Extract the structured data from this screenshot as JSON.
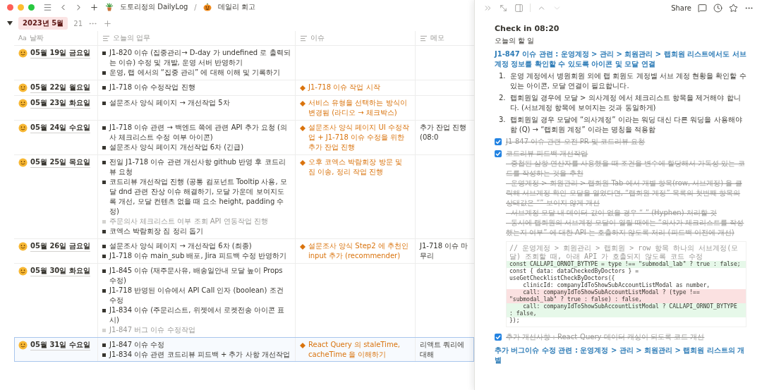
{
  "window": {
    "breadcrumbs": [
      {
        "label": "도토리정의 DailyLog"
      },
      {
        "label": "데일리 회고"
      }
    ],
    "separator": "/"
  },
  "group": {
    "label": "2023년 5월",
    "count": "21",
    "expanded": true
  },
  "table": {
    "columns": [
      {
        "kind": "title",
        "icon_text": "Aa",
        "label": "날짜"
      },
      {
        "kind": "text",
        "label": "오늘의 업무"
      },
      {
        "kind": "text",
        "label": "이슈"
      },
      {
        "kind": "text",
        "label": "메모"
      }
    ],
    "rows": [
      {
        "selected": false,
        "date": "05월 19일 금요일",
        "tasks": [
          {
            "text": "J1-820 이슈 (집중관리→ D-day 가 undefined 로 출력되는 이슈) 수정 및 개발, 운영 서버 반영하기",
            "muted": false
          },
          {
            "text": "운영, 랩 에서의 “집중 관리” 에 대해 이해 및 기록하기",
            "muted": false
          }
        ],
        "issues": []
      },
      {
        "selected": false,
        "date": "05월 22일 월요일",
        "tasks": [
          {
            "text": "J1-718 이슈 수정작업 진행",
            "muted": false
          }
        ],
        "issues": [
          "J1-718 이슈 작업 시작"
        ]
      },
      {
        "selected": false,
        "date": "05월 23일 화요일",
        "tasks": [
          {
            "text": "설문조사 양식 페이지 → 개선작업 5차",
            "muted": false
          }
        ],
        "issues": [
          "서비스 유형을 선택하는 방식이 변경됨 (라디오 → 체크박스)"
        ]
      },
      {
        "selected": false,
        "date": "05월 24일 수요일",
        "tasks": [
          {
            "text": "J1-718 이슈 관련 → 백엔드 쪽에 관련 API 추가 요청 (의사 체크리스트 수정 여부 아이콘)",
            "muted": false
          },
          {
            "text": "설문조사 양식 페이지 개선작업 6차 (긴급)",
            "muted": false
          }
        ],
        "issues": [
          "설문조사 양식 페이지 UI 수정작업 + J1-718 이슈 수정을 위한 추가 잔업 진행"
        ],
        "memo": "추가 잔업 진행 (08:0"
      },
      {
        "selected": false,
        "date": "05월 25일 목요일",
        "tasks": [
          {
            "text": "전일 J1-718 이슈 관련 개선사항 github 반영 후 코드리뷰 요청",
            "muted": false
          },
          {
            "text": "코드리뷰 개선작업 진행 (공통 컴포넌트 Tooltip 사용, 모달 dnd 관련 잔상 이슈 해결하기, 모달 가운데 보여지도록 개선, 모달 컨텐츠 없을 때 요소 height, padding 수정)",
            "muted": false
          },
          {
            "text": "주문의사 체크리스트 여부 조회 API 연동작업 진행",
            "muted": true
          },
          {
            "text": "코엑스 박람회장 짐 정리 돕기",
            "muted": false
          }
        ],
        "issues": [
          "오후 코엑스 박람회장 방문 및 짐 이송, 정리 작업 진행"
        ]
      },
      {
        "selected": false,
        "date": "05월 26일 금요일",
        "tasks": [
          {
            "text": "설문조사 양식 페이지 → 개선작업 6차 (최종)",
            "muted": false
          },
          {
            "text": "J1-718 이슈 main_sub 배포, Jira 피드백 수정 반영하기",
            "muted": false
          }
        ],
        "issues": [
          "설문조사 양식 Step2 에 추천인 input 추가 (recommender)"
        ],
        "memo": "J1-718 이슈 마무리"
      },
      {
        "selected": false,
        "date": "05월 30일 화요일",
        "tasks": [
          {
            "text": "J1-845 이슈 (재주문사유, 배송일안내 모달 높이 Props 수정)",
            "muted": false
          },
          {
            "text": "J1-718 반영된 이슈에서 API Call 인자 (boolean) 조건 수정",
            "muted": false
          },
          {
            "text": "J1-834 이슈 (주문리스트, 위젯에서 로켓전송 아이콘 표시)",
            "muted": false
          },
          {
            "text": "J1-847 버그 이슈 수정작업",
            "muted": true
          }
        ],
        "issues": []
      },
      {
        "selected": true,
        "date": "05월 31일 수요일",
        "tasks": [
          {
            "text": "J1-847 이슈 수정",
            "muted": false
          },
          {
            "text": "J1-834 이슈 관련 코드리뷰 피드백 + 추가 사항 개선작업",
            "muted": false
          }
        ],
        "issues": [
          "React Query 의 staleTime, cacheTime 을 이해하기"
        ],
        "memo": "리액트 쿼리에 대해"
      }
    ]
  },
  "peek": {
    "share": "Share",
    "blocks": [
      {
        "kind": "title",
        "text": "Check in 08:20"
      },
      {
        "kind": "text",
        "text": "오늘의 할 일"
      },
      {
        "kind": "heading",
        "text": "J1-847 이슈 관련 : 운영계정 > 관리 > 회원관리 > 랩회원 리스트에서도 서브계정 정보를 확인할 수 있도록 아이콘 및 모달 연결"
      },
      {
        "kind": "numbered",
        "number": "1.",
        "text": "운영 계정에서 병원회원 외에 랩 회원도 계정별 서브 계정 현황을 확인할 수 있는 아이콘, 모달 연결이 필요합니다."
      },
      {
        "kind": "numbered",
        "number": "2.",
        "text": "랩회원일 경우에 모달 > 의사계정 에서 체크리스트 항목을 제거해야 합니다. (서브계정 항목에 보여지는 것과 동일하게)"
      },
      {
        "kind": "numbered",
        "number": "3.",
        "text": "랩회원일 경우 모달에 “의사계정” 이라는 워딩 대신 다른 워딩을 사용해야 함 (Q) → “랩회원 계정” 이라는 명칭을 적용함"
      },
      {
        "kind": "todo",
        "checked": true,
        "text": "J1-847 이슈 관련 오전 PR 및 코드리뷰 요청"
      },
      {
        "kind": "todo",
        "checked": true,
        "text": "코드리뷰 피드백 개선작업",
        "lines": [
          "- 중첩된 삼항 연산자를 사용했을 때 조건을 변수에 할당해서 가독성 있는 코드를 작성하는 것을 추천",
          "- 운영계정 > 회원관리 > 랩회원 Tab 에서 개별 항목(row, 서브계정) 을 클릭해 서브계정 확인 모달을 열었다면, “랩회원 계정” 목록의 첫번째 항목의 상태값은 “” 보이지 않게 개선",
          "- 서브계정 모달 내 데이터 값이 없을 경우 “-” (Hyphen) 처리할 것",
          "- 동시에 랩회원의 서브계정 모달이 열릴 때에는 “의사가 체크리스트를 작성했는지 여부” 에 대한 API 는 호출하지 않도록 처리 (피드백 이전에 개선)"
        ]
      },
      {
        "kind": "code",
        "lines": [
          {
            "kind": "comment",
            "text": "// 운영계정 > 회원관리 > 랩회원 > row 항목 하나의 서브계정(모달) 조회할 때, 아래 API 가 호출되지 않도록 코드 수정"
          },
          {
            "kind": "added",
            "text": "const CALLAPI_ORNOT_BYTYPE = type !== \"submodal_lab\" ? true : false;"
          },
          {
            "kind": "plain",
            "text": "const { data: dataCheckedByDoctors } = useGetChecklistCheckByDoctors({"
          },
          {
            "kind": "plain",
            "text": "    clinicId: companyIdToShowSubAccountListModal as number,"
          },
          {
            "kind": "removed",
            "text": "    call: companyIdToShowSubAccountListModal ? (type !== \"submodal_lab\" ? true : false) : false,"
          },
          {
            "kind": "added",
            "text": "    call: companyIdToShowSubAccountListModal ? CALLAPI_ORNOT_BYTYPE : false,"
          },
          {
            "kind": "plain",
            "text": "});"
          }
        ]
      },
      {
        "kind": "todo",
        "checked": true,
        "text": "추가 개선사항 : React-Query 데이터 캐싱이 되도록 코드 개선"
      },
      {
        "kind": "heading",
        "text": "추가 버그이슈 수정 관련 : 운영계정 > 관리 > 회원관리 > 랩회원 리스트의 개별"
      }
    ]
  }
}
